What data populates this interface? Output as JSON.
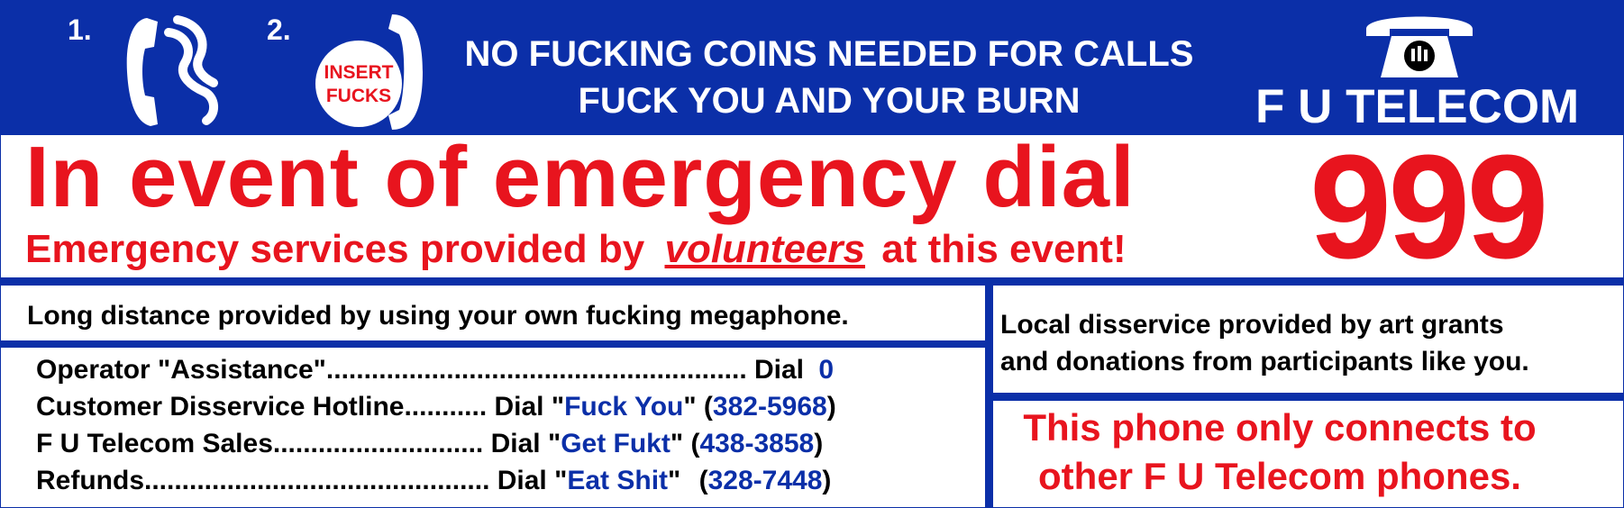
{
  "header": {
    "step1": "1.",
    "step2": "2.",
    "coin_slot_line1": "INSERT",
    "coin_slot_line2": "FUCKS",
    "line1": "NO FUCKING COINS NEEDED FOR CALLS",
    "line2": "FUCK YOU AND YOUR BURN",
    "brand": "F U TELECOM",
    "icons": [
      "phone-handset-icon",
      "phone-handset-icon",
      "rotary-phone-icon"
    ]
  },
  "emergency": {
    "headline": "In event of emergency dial",
    "number": "999",
    "sub_before": "Emergency services provided by",
    "sub_emphasis": "volunteers",
    "sub_after": "at this event!"
  },
  "long_distance": "Long distance provided by using your own fucking megaphone.",
  "directory": [
    {
      "label": "Operator \"Assistance\"........................................................ Dial",
      "quote_open": "",
      "name": "",
      "quote_close": "",
      "number": "0"
    },
    {
      "label": "Customer Disservice Hotline........... Dial ",
      "quote_open": "\"",
      "name": "Fuck You",
      "quote_close": "\"",
      "number": "382-5968"
    },
    {
      "label": "F U Telecom Sales............................ Dial ",
      "quote_open": "\"",
      "name": "Get Fukt",
      "quote_close": "\"",
      "number": "438-3858"
    },
    {
      "label": "Refunds.............................................. Dial ",
      "quote_open": "\"",
      "name": "Eat Shit",
      "quote_close": "\"",
      "number": "328-7448"
    }
  ],
  "local": {
    "line1": "Local disservice provided by art grants",
    "line2": "and donations from participants like you."
  },
  "connects": {
    "line1": "This phone only connects to",
    "line2": "other F U Telecom phones."
  },
  "colors": {
    "blue": "#0b2fa8",
    "red": "#e8141e",
    "white": "#ffffff"
  }
}
